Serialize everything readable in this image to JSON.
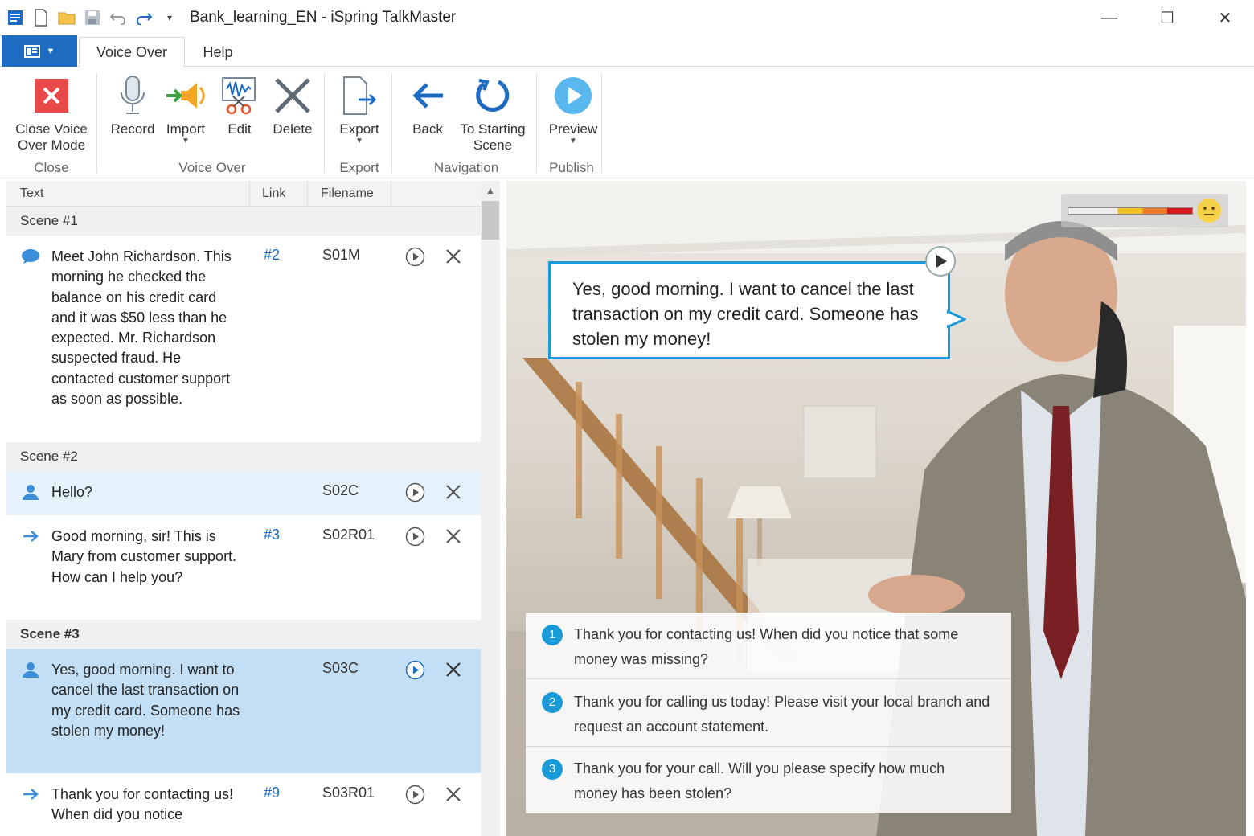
{
  "window": {
    "title": "Bank_learning_EN - iSpring TalkMaster",
    "minimize": "—",
    "maximize": "☐",
    "close": "✕"
  },
  "ribbon_tabs": {
    "voice_over": "Voice Over",
    "help": "Help"
  },
  "ribbon": {
    "close_voice_over": "Close Voice Over Mode",
    "record": "Record",
    "import": "Import",
    "edit": "Edit",
    "delete": "Delete",
    "export": "Export",
    "back": "Back",
    "to_starting_scene": "To Starting Scene",
    "preview": "Preview",
    "groups": {
      "close": "Close",
      "voice_over": "Voice Over",
      "export": "Export",
      "navigation": "Navigation",
      "publish": "Publish"
    }
  },
  "columns": {
    "text": "Text",
    "link": "Link",
    "filename": "Filename"
  },
  "scenes": [
    {
      "title": "Scene #1",
      "rows": [
        {
          "icon": "speech-bubble-icon",
          "text": "Meet John Richardson. This morning he checked the balance on his credit card and it was $50 less than he expected. Mr. Richardson suspected fraud. He contacted customer support as soon as possible.",
          "link": "#2",
          "filename": "S01M"
        }
      ]
    },
    {
      "title": "Scene #2",
      "rows": [
        {
          "icon": "person-icon",
          "text": "Hello?",
          "link": "",
          "filename": "S02C"
        },
        {
          "icon": "reply-arrow-icon",
          "text": "Good morning, sir! This is Mary from customer support. How can I help you?",
          "link": "#3",
          "filename": "S02R01"
        }
      ]
    },
    {
      "title": "Scene #3",
      "rows": [
        {
          "icon": "person-icon",
          "text": "Yes, good morning. I want to cancel the last transaction on my credit card. Someone has stolen my money!",
          "link": "",
          "filename": "S03C"
        },
        {
          "icon": "reply-arrow-icon",
          "text": "Thank you for contacting us! When did you notice",
          "link": "#9",
          "filename": "S03R01"
        }
      ]
    }
  ],
  "preview": {
    "speech": "Yes, good morning. I want to cancel the last transaction on my credit card. Someone has stolen my money!",
    "answers": [
      {
        "num": "1",
        "text": "Thank you for contacting us! When did you notice that some money was missing?"
      },
      {
        "num": "2",
        "text": "Thank you for calling us today! Please visit your local branch and request an account statement."
      },
      {
        "num": "3",
        "text": "Thank you for your call. Will you please specify how much money has been stolen?"
      }
    ]
  },
  "colors": {
    "accent": "#1e6cc2",
    "bubble_border": "#1a9ad6",
    "selected_row": "#c3dff5",
    "selected_row_light": "#e5f2fc"
  }
}
